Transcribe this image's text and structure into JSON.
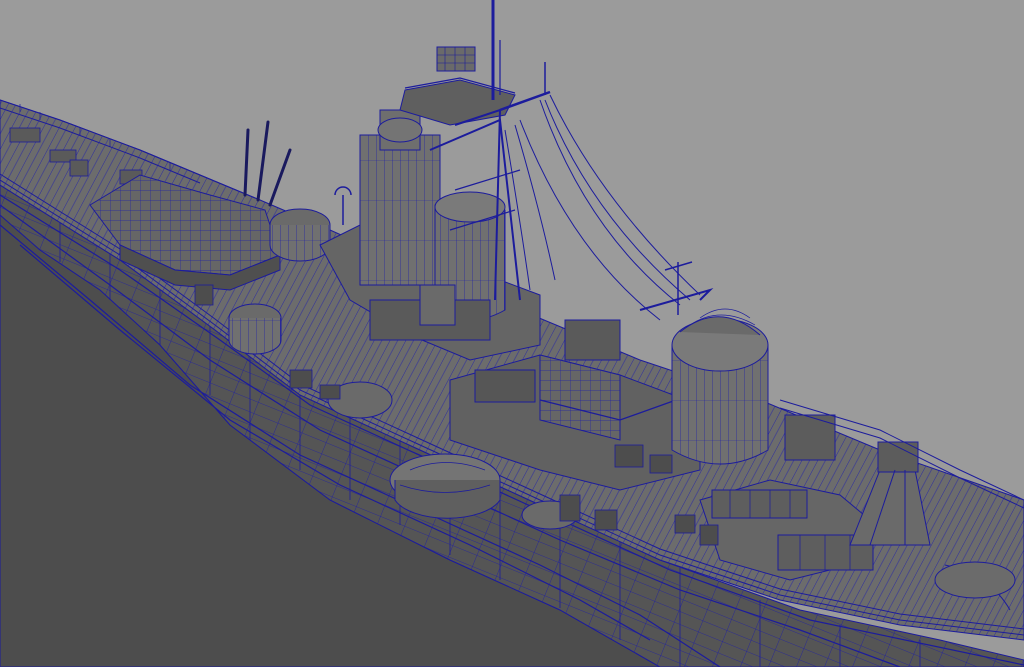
{
  "viewport": {
    "background": "#9b9b9b",
    "wire_color": "#1c1c9c",
    "shade_dark": "#4a4a4a",
    "shade_mid": "#5e5e5e",
    "shade_light": "#6f6f6f",
    "shade_top": "#7a7a7a"
  },
  "model": {
    "label": "battleship-wireframe-model",
    "shading_mode": "wireframe-on-shaded"
  }
}
